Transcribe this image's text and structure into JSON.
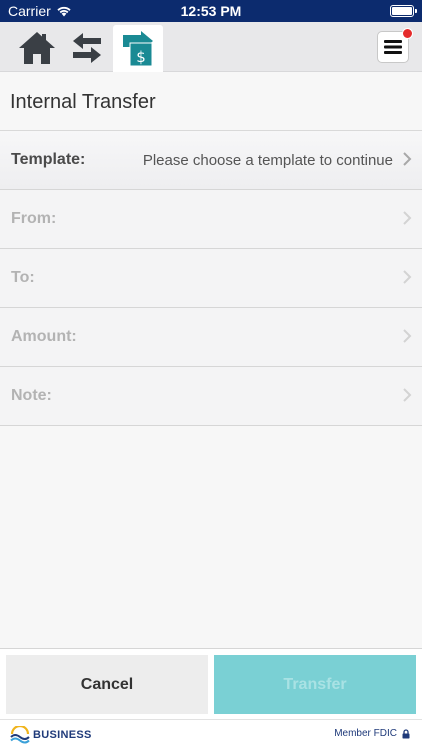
{
  "status_bar": {
    "carrier": "Carrier",
    "time": "12:53 PM"
  },
  "nav": {
    "tabs": [
      {
        "name": "home",
        "icon": "home-icon"
      },
      {
        "name": "transfers",
        "icon": "transfer-arrows-icon"
      },
      {
        "name": "internal-transfer",
        "icon": "internal-transfer-icon",
        "active": true
      }
    ],
    "menu_icon": "hamburger-menu-icon",
    "menu_badge_color": "#e52b2b"
  },
  "page": {
    "title": "Internal Transfer"
  },
  "form": {
    "template": {
      "label": "Template:",
      "value": "Please choose a template to continue"
    },
    "from": {
      "label": "From:"
    },
    "to": {
      "label": "To:"
    },
    "amount": {
      "label": "Amount:"
    },
    "note": {
      "label": "Note:"
    }
  },
  "actions": {
    "cancel_label": "Cancel",
    "transfer_label": "Transfer"
  },
  "footer": {
    "brand": "BUSINESS",
    "fdic": "Member FDIC"
  },
  "colors": {
    "status_bar": "#0c2b6e",
    "accent_teal": "#1a8a94",
    "transfer_button": "#7ad0d4"
  }
}
